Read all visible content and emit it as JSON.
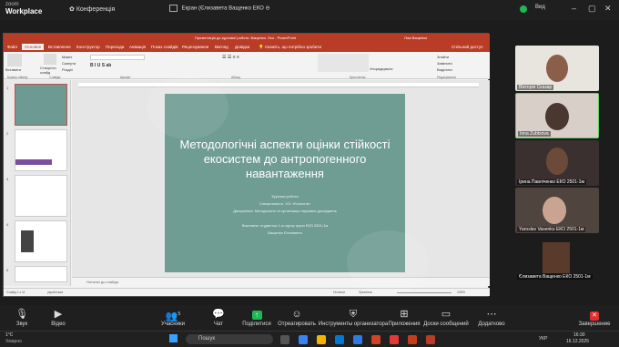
{
  "zoom": {
    "logo_small": "zoom",
    "logo_big": "Workplace",
    "conference_label": "Конференція",
    "share_title": "Екран (Єлизавета Ващенко ЕКО",
    "view_label": "Вид"
  },
  "ppt": {
    "title": "Презентація до курсової роботи. Ващенко. Еко - PowerPoint",
    "user": "Ліза Ващенко",
    "tabs": [
      "Файл",
      "Основне",
      "Вставлення",
      "Конструктор",
      "Переходи",
      "Анімація",
      "Показ слайдів",
      "Рецензування",
      "Вигляд",
      "Довідка"
    ],
    "tell_me": "Скажіть, що потрібно зробити",
    "share_btn": "Спільний доступ",
    "ribbon": {
      "paste": "Вставити",
      "new_slide": "Створити слайд",
      "layout": "Макет",
      "reset": "Скинути",
      "section": "Розділ",
      "find": "Знайти",
      "replace": "Замінити",
      "select": "Виділити",
      "arrange": "Упорядкувати",
      "groups": [
        "Буфер обміну",
        "Слайди",
        "Шрифт",
        "Абзац",
        "Креслення",
        "Редагування"
      ]
    },
    "slide": {
      "title": "Методологічні аспекти оцінки стійкості екосистем до антропогенного навантаження",
      "lines": [
        "Курсова робота",
        "Спеціальність: 101 «Екологія»",
        "Дисципліна: Методологія та організація наукових досліджень",
        "",
        "Виконала: студентка 1-го курсу групи ЕКО 2501-1м",
        "Ващенко Єлизавета"
      ]
    },
    "notes": "Нотатки до слайда",
    "status": {
      "slide": "Слайд 1 з 11",
      "lang": "українська",
      "notes": "Нотатки",
      "comments": "Примітки",
      "zoom": "105%"
    }
  },
  "participants": [
    {
      "name": "Вікторія Сказар"
    },
    {
      "name": "Inna Zubtsova"
    },
    {
      "name": "Ірина Павліченко ЕКО 2501-1м"
    },
    {
      "name": "Yaroslav Vasenko ЕКО 2501-1м"
    },
    {
      "name": "Єлизавета Ващенко ЕКО 2501-1м"
    }
  ],
  "controls": {
    "audio": "Звук",
    "video": "Відео",
    "participants": "Учасники",
    "participants_count": "5",
    "chat": "Чат",
    "share": "Поділитися",
    "react": "Отреагировать",
    "host_tools": "Инструменты организатора",
    "apps": "Приложения",
    "whiteboards": "Доски сообщений",
    "more": "Додатково",
    "end": "Завершение"
  },
  "taskbar": {
    "weather_temp": "1°C",
    "weather_desc": "Хмарно",
    "search": "Пошук",
    "lang": "УКР",
    "time": "16:30",
    "date": "16.12.2025"
  },
  "colors": {
    "ppt_accent": "#b83c26",
    "slide_bg": "#6f9d94",
    "share_green": "#1db954",
    "end_red": "#e02f2f"
  }
}
